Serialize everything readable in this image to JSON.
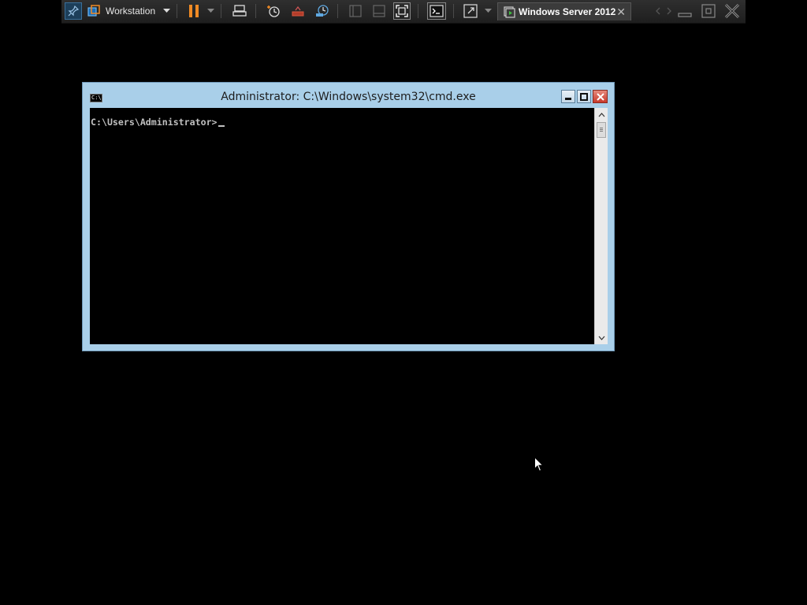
{
  "toolbar": {
    "workstation_label": "Workstation",
    "icons": [
      "pin-icon",
      "library-icon",
      "pause-icon",
      "send-keys-icon",
      "snapshot-icon",
      "revert-snapshot-icon",
      "snapshot-manager-icon",
      "library-panel-icon",
      "thumbnail-bar-icon",
      "fullscreen-icon",
      "console-icon",
      "unity-icon"
    ],
    "vm_tab": {
      "label": "Windows Server 2012",
      "close": "✕"
    },
    "accent_color": "#f08a24"
  },
  "cmd_window": {
    "title": "Administrator: C:\\Windows\\system32\\cmd.exe",
    "icon_text": "C:\\",
    "prompt": "C:\\Users\\Administrator>",
    "title_bar_color": "#a9cfe9"
  }
}
